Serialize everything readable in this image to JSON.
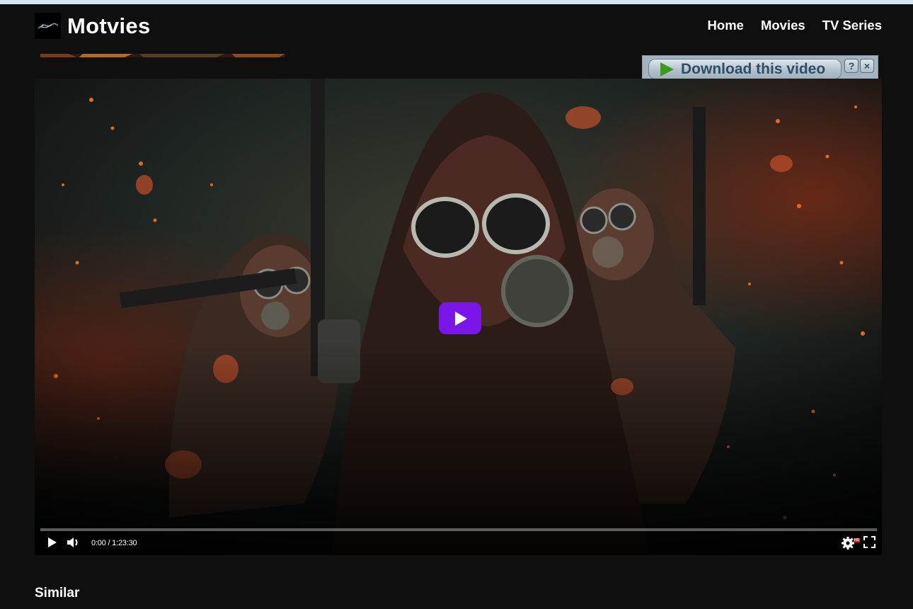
{
  "header": {
    "site_title": "Motvies",
    "nav": [
      "Home",
      "Movies",
      "TV Series"
    ]
  },
  "download_bar": {
    "label": "Download this video",
    "help": "?",
    "close": "×"
  },
  "player": {
    "current_time": "0:00",
    "duration": "1:23:30",
    "time_display": "0:00 / 1:23:30",
    "progress": 0,
    "hd_badge": "HD"
  },
  "sections": {
    "similar": "Similar"
  },
  "colors": {
    "background": "#0f0f0f",
    "accent": "#7b16e8",
    "download_play": "#3a9b1f"
  },
  "icons": {
    "logo": "logo-icon",
    "play": "play-icon",
    "volume": "volume-icon",
    "settings": "gear-icon",
    "fullscreen": "fullscreen-icon"
  }
}
